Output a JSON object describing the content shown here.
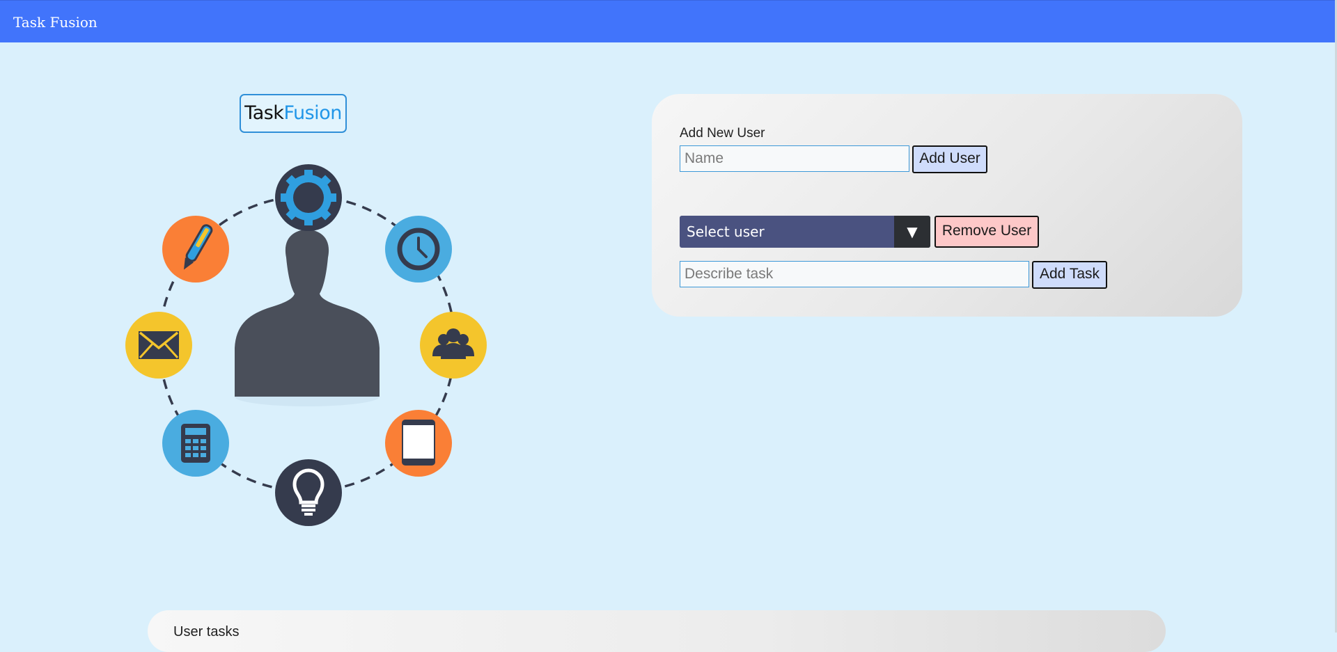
{
  "app": {
    "title": "Task Fusion"
  },
  "hero": {
    "logo_part1": "Task",
    "logo_part2": "Fusion",
    "icons": [
      "gear-icon",
      "clock-icon",
      "group-icon",
      "clipboard-icon",
      "lightbulb-icon",
      "calculator-icon",
      "envelope-icon",
      "pen-icon",
      "user-silhouette-icon"
    ]
  },
  "form": {
    "add_user_label": "Add New User",
    "name_placeholder": "Name",
    "name_value": "",
    "add_user_button": "Add User",
    "select_user_value": "Select user",
    "remove_user_button": "Remove User",
    "task_placeholder": "Describe task",
    "task_value": "",
    "add_task_button": "Add Task"
  },
  "bottom_panel": {
    "title": "User tasks"
  },
  "colors": {
    "topbar": "#4174fb",
    "background": "#daf0fc",
    "select_bg": "#4a5280",
    "remove_btn": "#fdc8c8",
    "add_btn": "#cfdcfb",
    "accent_blue": "#2196e8",
    "icon_dark": "#353b4d",
    "icon_orange": "#fa7f36",
    "icon_yellow": "#f4c52c",
    "icon_lightblue": "#4aace0"
  }
}
